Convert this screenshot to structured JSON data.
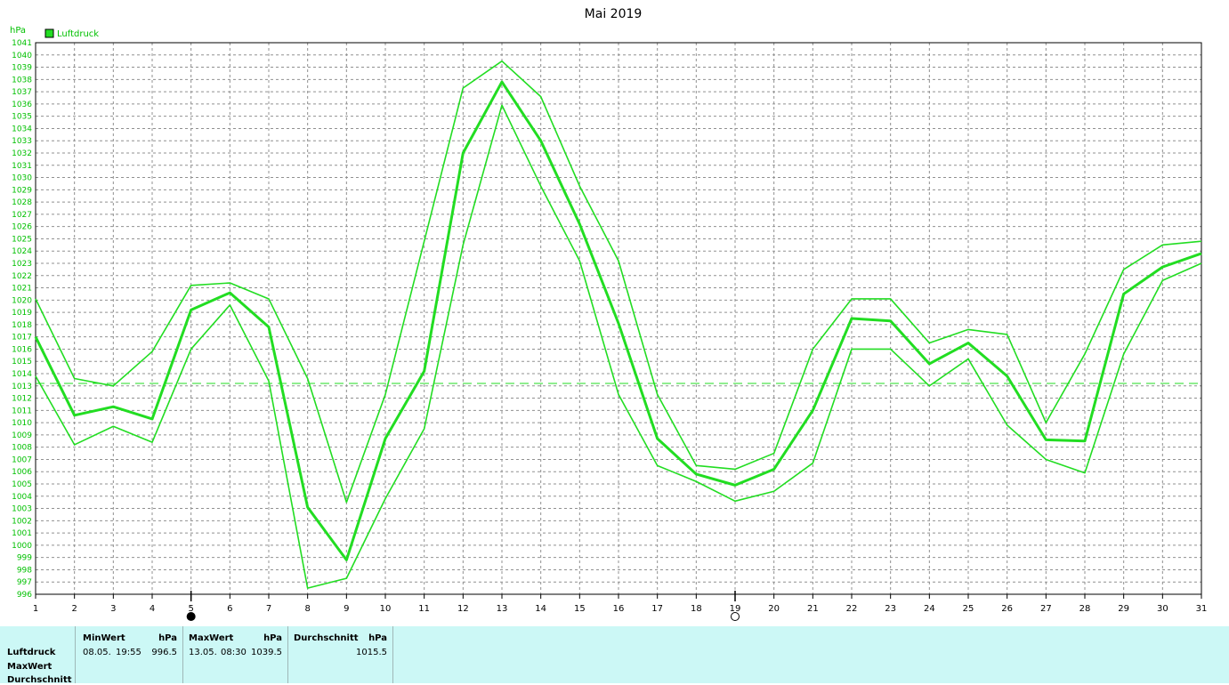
{
  "chart_data": {
    "type": "line",
    "title": "Mai 2019",
    "y_unit": "hPa",
    "ylim": [
      996,
      1041
    ],
    "x": [
      1,
      2,
      3,
      4,
      5,
      6,
      7,
      8,
      9,
      10,
      11,
      12,
      13,
      14,
      15,
      16,
      17,
      18,
      19,
      20,
      21,
      22,
      23,
      24,
      25,
      26,
      27,
      28,
      29,
      30,
      31
    ],
    "legend": [
      "Luftdruck"
    ],
    "series": [
      {
        "name": "Luftdruck",
        "role": "max",
        "values": [
          1020.1,
          1013.6,
          1013.0,
          1015.8,
          1021.2,
          1021.4,
          1020.1,
          1013.6,
          1003.5,
          1012.3,
          1024.8,
          1037.3,
          1039.5,
          1036.6,
          1029.3,
          1023.2,
          1012.3,
          1006.5,
          1006.2,
          1007.5,
          1016.0,
          1020.1,
          1020.1,
          1016.5,
          1017.6,
          1017.2,
          1010.0,
          1015.6,
          1022.5,
          1024.5,
          1024.8
        ]
      },
      {
        "name": "Luftdruck",
        "role": "avg",
        "values": [
          1017.0,
          1010.6,
          1011.3,
          1010.3,
          1019.2,
          1020.6,
          1017.8,
          1003.1,
          998.8,
          1008.7,
          1014.2,
          1032.0,
          1037.8,
          1033.0,
          1026.2,
          1018.1,
          1008.7,
          1005.8,
          1004.9,
          1006.2,
          1011.0,
          1018.5,
          1018.3,
          1014.8,
          1016.5,
          1013.8,
          1008.6,
          1008.5,
          1020.5,
          1022.7,
          1023.8
        ]
      },
      {
        "name": "Luftdruck",
        "role": "min",
        "values": [
          1013.8,
          1008.2,
          1009.7,
          1008.4,
          1016.0,
          1019.6,
          1013.4,
          996.5,
          997.3,
          1003.8,
          1009.5,
          1024.5,
          1035.9,
          1029.3,
          1023.2,
          1012.3,
          1006.5,
          1005.2,
          1003.6,
          1004.4,
          1006.7,
          1016.0,
          1016.0,
          1013.0,
          1015.2,
          1009.8,
          1007.0,
          1005.9,
          1015.6,
          1021.6,
          1023.0
        ]
      }
    ],
    "average_line": 1013.2,
    "grid": true,
    "moon_markers": [
      {
        "day": 5,
        "phase": "new"
      },
      {
        "day": 19,
        "phase": "full"
      }
    ],
    "colors": {
      "series": "#22dd22",
      "legend_fill": "#22dd22",
      "text_green": "#00c000",
      "grid": "#909090"
    }
  },
  "stats_table": {
    "row_labels": [
      "Luftdruck",
      "MaxWert",
      "Durchschnitt"
    ],
    "min": {
      "header": "MinWert",
      "unit": "hPa",
      "date": "08.05.",
      "time": "19:55",
      "value": "996.5"
    },
    "max": {
      "header": "MaxWert",
      "unit": "hPa",
      "date": "13.05.",
      "time": "08:30",
      "value": "1039.5"
    },
    "avg": {
      "header": "Durchschnitt",
      "unit": "hPa",
      "value": "1015.5"
    },
    "background": "#ccf8f6"
  }
}
